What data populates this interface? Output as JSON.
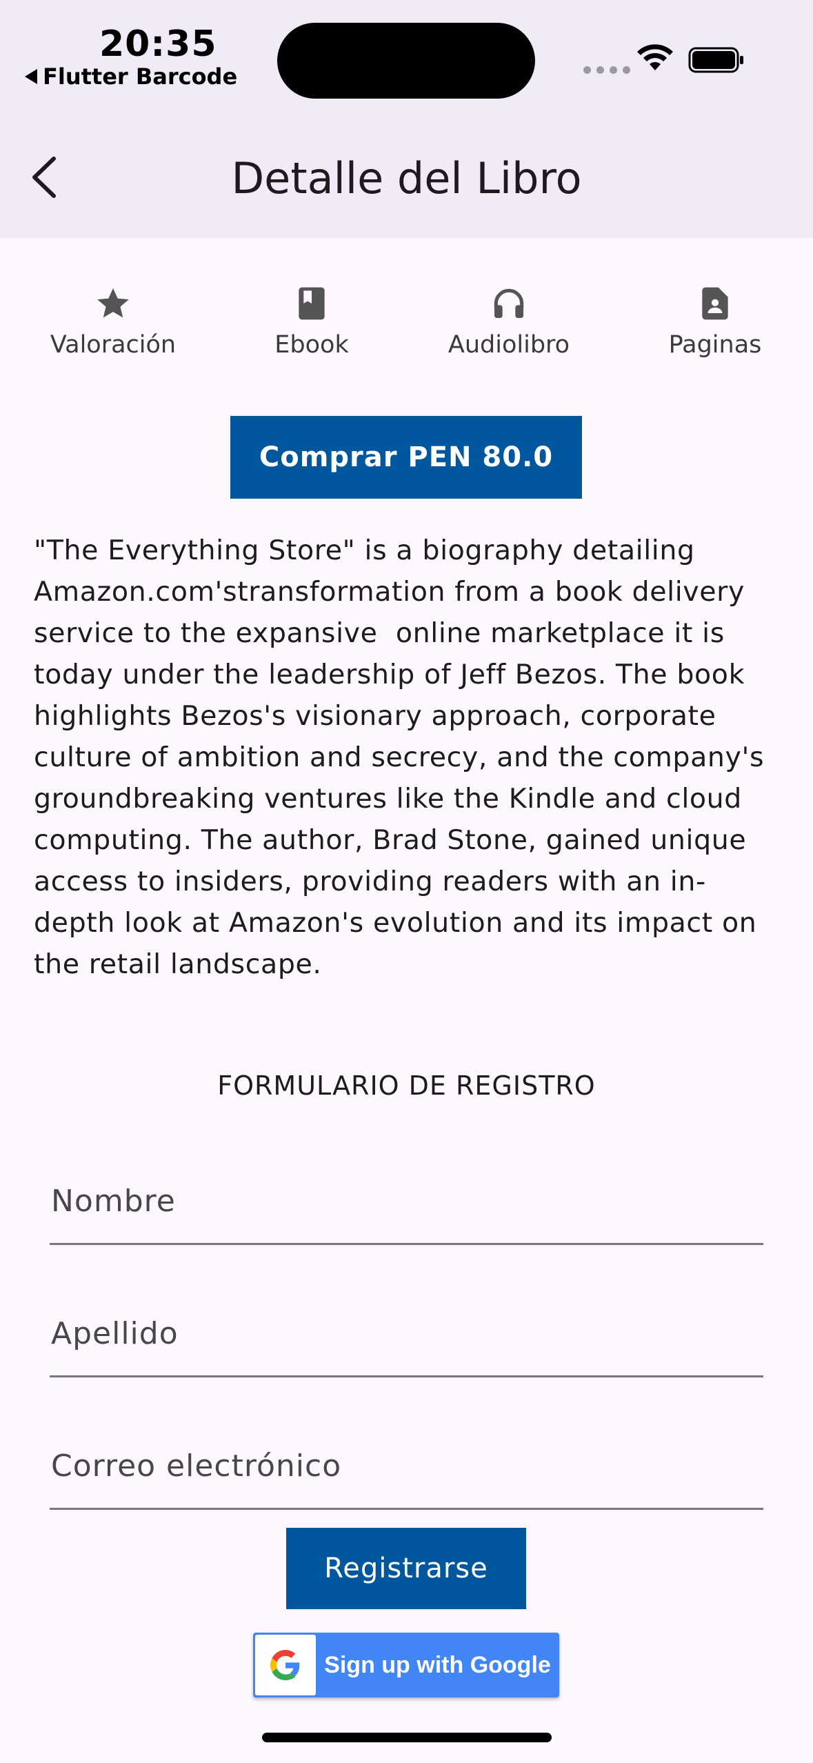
{
  "status_bar": {
    "time": "20:35",
    "back_app": "Flutter Barcode"
  },
  "app_bar": {
    "title": "Detalle del Libro"
  },
  "info_items": [
    {
      "icon": "star-icon",
      "label": "Valoración"
    },
    {
      "icon": "book-icon",
      "label": "Ebook"
    },
    {
      "icon": "headphones-icon",
      "label": "Audiolibro"
    },
    {
      "icon": "document-icon",
      "label": "Paginas"
    }
  ],
  "buy_button": {
    "label": "Comprar PEN 80.0"
  },
  "description": "\"The Everything Store\" is a biography detailing\nAmazon.com'stransformation from a book delivery\nservice to the expansive  online marketplace it is\ntoday under the leadership of Jeff Bezos. The book\nhighlights Bezos's visionary approach, corporate\nculture of ambition and secrecy, and the company's\ngroundbreaking ventures like the Kindle and cloud\ncomputing. The author, Brad Stone, gained unique\naccess to insiders, providing readers with an in-\ndepth look at Amazon's evolution and its impact on\nthe retail landscape.",
  "form": {
    "title": "FORMULARIO DE REGISTRO",
    "fields": [
      {
        "placeholder": "Nombre",
        "value": ""
      },
      {
        "placeholder": "Apellido",
        "value": ""
      },
      {
        "placeholder": "Correo electrónico",
        "value": ""
      }
    ],
    "register_label": "Registrarse",
    "google_label": "Sign up with Google"
  },
  "colors": {
    "primary": "#00579E",
    "header_bg": "#F1EBF7",
    "page_bg": "#FEF7FF",
    "google_blue": "#4285F4"
  }
}
